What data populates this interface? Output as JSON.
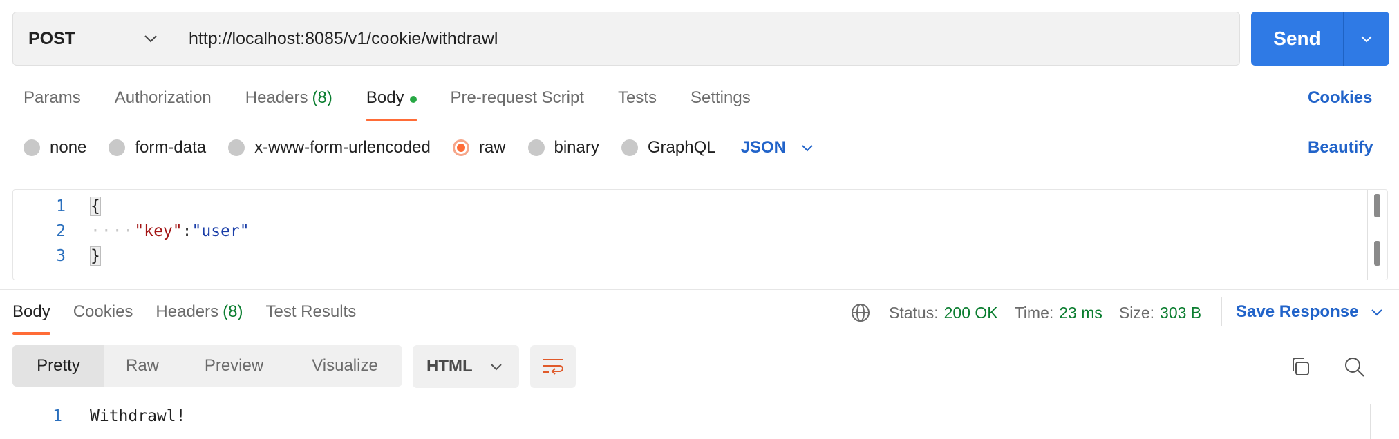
{
  "request": {
    "method": "POST",
    "url": "http://localhost:8085/v1/cookie/withdrawl",
    "send_label": "Send"
  },
  "request_tabs": [
    {
      "label": "Params"
    },
    {
      "label": "Authorization"
    },
    {
      "label": "Headers",
      "count": "(8)"
    },
    {
      "label": "Body",
      "active": true
    },
    {
      "label": "Pre-request Script"
    },
    {
      "label": "Tests"
    },
    {
      "label": "Settings"
    }
  ],
  "cookies_link": "Cookies",
  "body_types": [
    {
      "label": "none"
    },
    {
      "label": "form-data"
    },
    {
      "label": "x-www-form-urlencoded"
    },
    {
      "label": "raw",
      "selected": true
    },
    {
      "label": "binary"
    },
    {
      "label": "GraphQL"
    }
  ],
  "body_format": "JSON",
  "beautify_label": "Beautify",
  "editor": {
    "line_numbers": [
      "1",
      "2",
      "3"
    ],
    "open_brace": "{",
    "indent": "····",
    "key": "\"key\"",
    "colon": ":",
    "value": "\"user\"",
    "close_brace": "}"
  },
  "response_tabs": [
    {
      "label": "Body",
      "active": true
    },
    {
      "label": "Cookies"
    },
    {
      "label": "Headers",
      "count": "(8)"
    },
    {
      "label": "Test Results"
    }
  ],
  "response_meta": {
    "status_label": "Status:",
    "status_value": "200 OK",
    "time_label": "Time:",
    "time_value": "23 ms",
    "size_label": "Size:",
    "size_value": "303 B"
  },
  "save_response_label": "Save Response",
  "view_modes": [
    "Pretty",
    "Raw",
    "Preview",
    "Visualize"
  ],
  "response_format": "HTML",
  "response_body": {
    "line_number": "1",
    "text": "Withdrawl!"
  },
  "colors": {
    "accent": "#ff6c37",
    "primary": "#2f7ae5",
    "link": "#2163c9",
    "success": "#0a7d2f"
  }
}
